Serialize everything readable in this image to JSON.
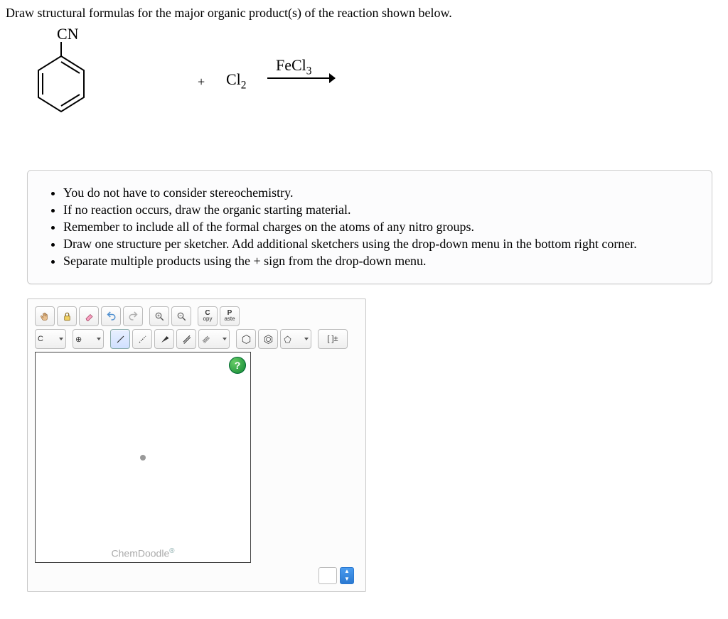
{
  "question": "Draw structural formulas for the major organic product(s) of the reaction shown below.",
  "reaction": {
    "substituent": "CN",
    "plus": "+",
    "reagent": "Cl",
    "reagent_sub": "2",
    "catalyst": "FeCl",
    "catalyst_sub": "3"
  },
  "notes": [
    "You do not have to consider stereochemistry.",
    "If no reaction occurs, draw the organic starting material.",
    "Remember to include all of the formal charges on the atoms of any nitro groups.",
    "Draw one structure per sketcher. Add additional sketchers using the drop-down menu in the bottom right corner.",
    "Separate multiple products using the + sign from the drop-down menu."
  ],
  "toolbar": {
    "copy_top": "C",
    "copy_bottom": "opy",
    "paste_top": "P",
    "paste_bottom": "aste",
    "element": "C",
    "charge": "⊕",
    "bracket": "[ ]±"
  },
  "canvas": {
    "brand": "ChemDoodle",
    "reg": "®",
    "help": "?"
  }
}
